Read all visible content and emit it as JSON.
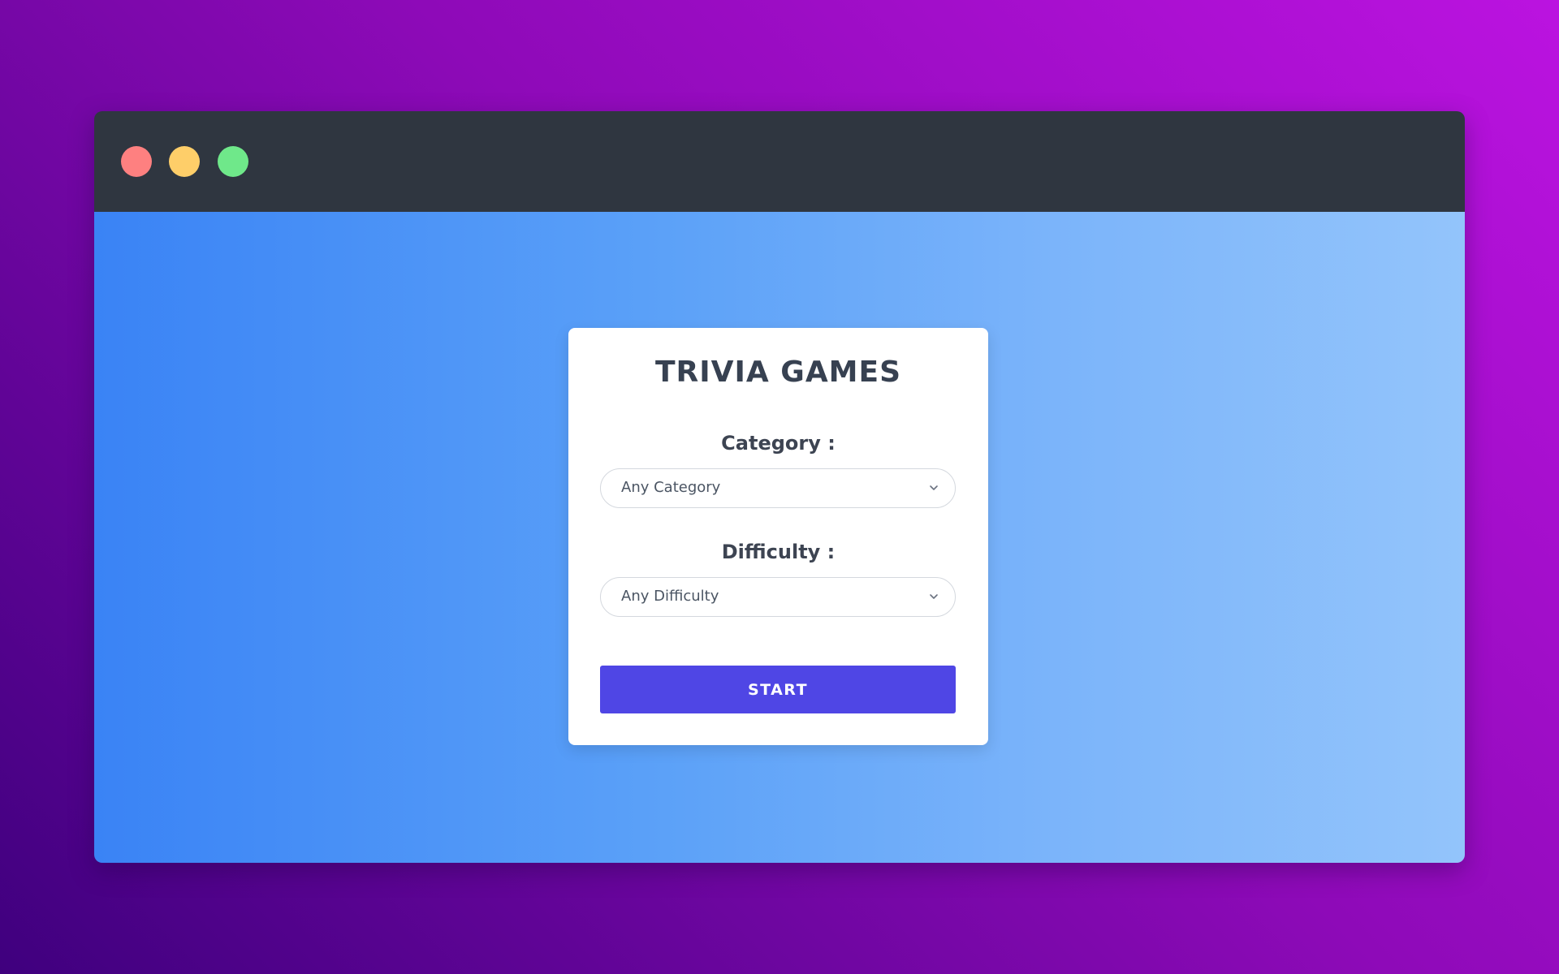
{
  "window": {
    "controls": [
      {
        "name": "close",
        "color": "#fe8080"
      },
      {
        "name": "minimize",
        "color": "#fece69"
      },
      {
        "name": "maximize",
        "color": "#6fe88a"
      }
    ]
  },
  "card": {
    "title": "TRIVIA GAMES",
    "category": {
      "label": "Category :",
      "selected": "Any Category",
      "icon": "chevron-down-icon"
    },
    "difficulty": {
      "label": "Difficulty :",
      "selected": "Any Difficulty",
      "icon": "chevron-down-icon"
    },
    "start_label": "START"
  },
  "colors": {
    "accent": "#4f46e5",
    "titlebar": "#2f3640",
    "heading": "#374151"
  }
}
